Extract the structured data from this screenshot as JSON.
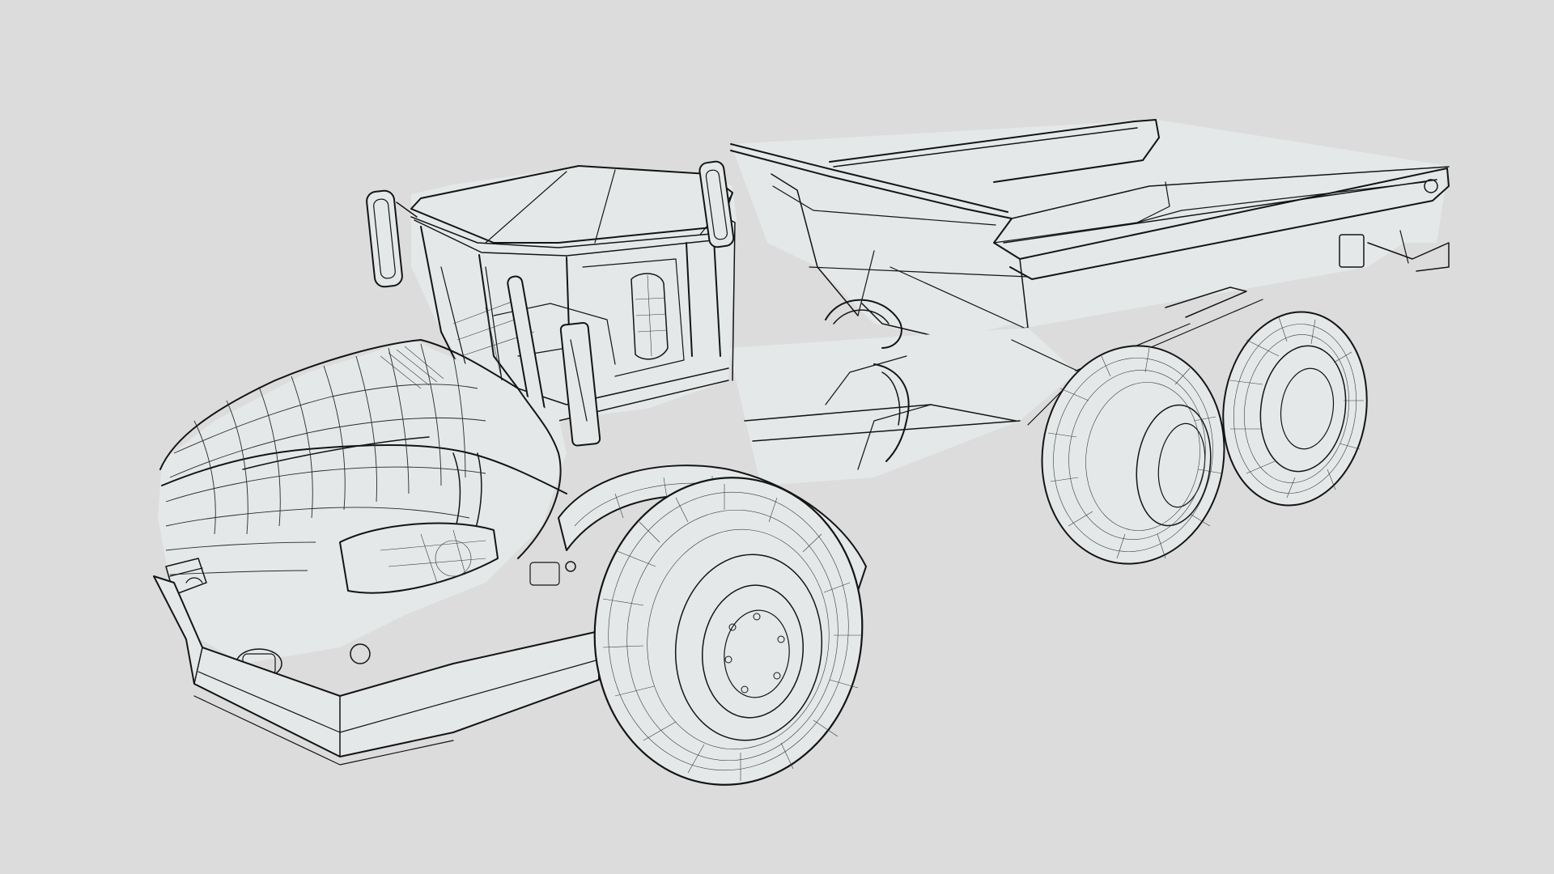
{
  "viewport": {
    "background_color": "#dcdcdc",
    "model_fill_color": "#e4e8e8",
    "line_color": "#141414",
    "render_mode": "wireframe"
  }
}
